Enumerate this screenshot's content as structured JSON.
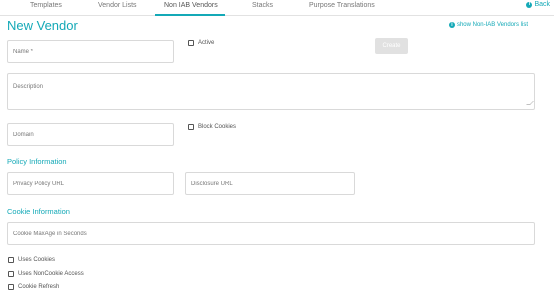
{
  "tabs": [
    {
      "label": "Templates"
    },
    {
      "label": "Vendor Lists"
    },
    {
      "label": "Non IAB Vendors"
    },
    {
      "label": "Stacks"
    },
    {
      "label": "Purpose Translations"
    }
  ],
  "active_tab": "Non IAB Vendors",
  "back_label": "Back",
  "page_title": "New Vendor",
  "show_link": "show Non-IAB Vendors list",
  "form": {
    "name_placeholder": "Name *",
    "active_label": "Active",
    "create_label": "Create",
    "description_placeholder": "Description",
    "domain_placeholder": "Domain",
    "block_cookies_label": "Block Cookies"
  },
  "policy": {
    "heading": "Policy Information",
    "privacy_policy_placeholder": "Privacy Policy URL",
    "disclosure_placeholder": "Disclosure URL"
  },
  "cookie": {
    "heading": "Cookie Information",
    "maxage_placeholder": "Cookie MaxAge in Seconds",
    "checkboxes": [
      {
        "label": "Uses Cookies"
      },
      {
        "label": "Uses NonCookie Access"
      },
      {
        "label": "Cookie Refresh"
      }
    ]
  },
  "colors": {
    "accent": "#14a9b7",
    "button_disabled": "#e1e1e1",
    "border": "#d9d9d9"
  },
  "icons": {
    "back": "info-circle-icon",
    "show_link": "info-circle-icon"
  }
}
